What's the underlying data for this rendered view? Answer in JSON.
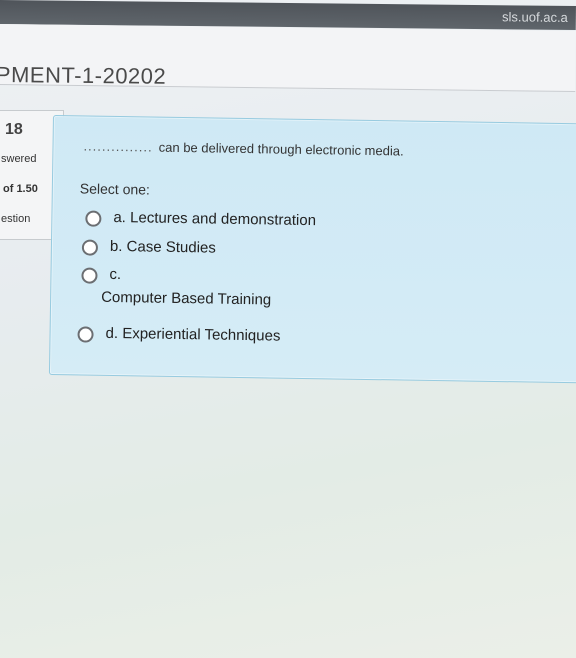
{
  "browser": {
    "url": "sls.uof.ac.a"
  },
  "header": {
    "title": "PMENT-1-20202"
  },
  "question_info": {
    "number": "18",
    "status": "swered",
    "mark": "of 1.50",
    "flag": "estion"
  },
  "question": {
    "blank": "...............",
    "text": "can be delivered through electronic media.",
    "prompt": "Select one:",
    "options": [
      {
        "letter": "a.",
        "text": "Lectures and demonstration"
      },
      {
        "letter": "b.",
        "text": "Case Studies"
      },
      {
        "letter": "c.",
        "text": "Computer Based Training"
      },
      {
        "letter": "d.",
        "text": "Experiential Techniques"
      }
    ]
  }
}
